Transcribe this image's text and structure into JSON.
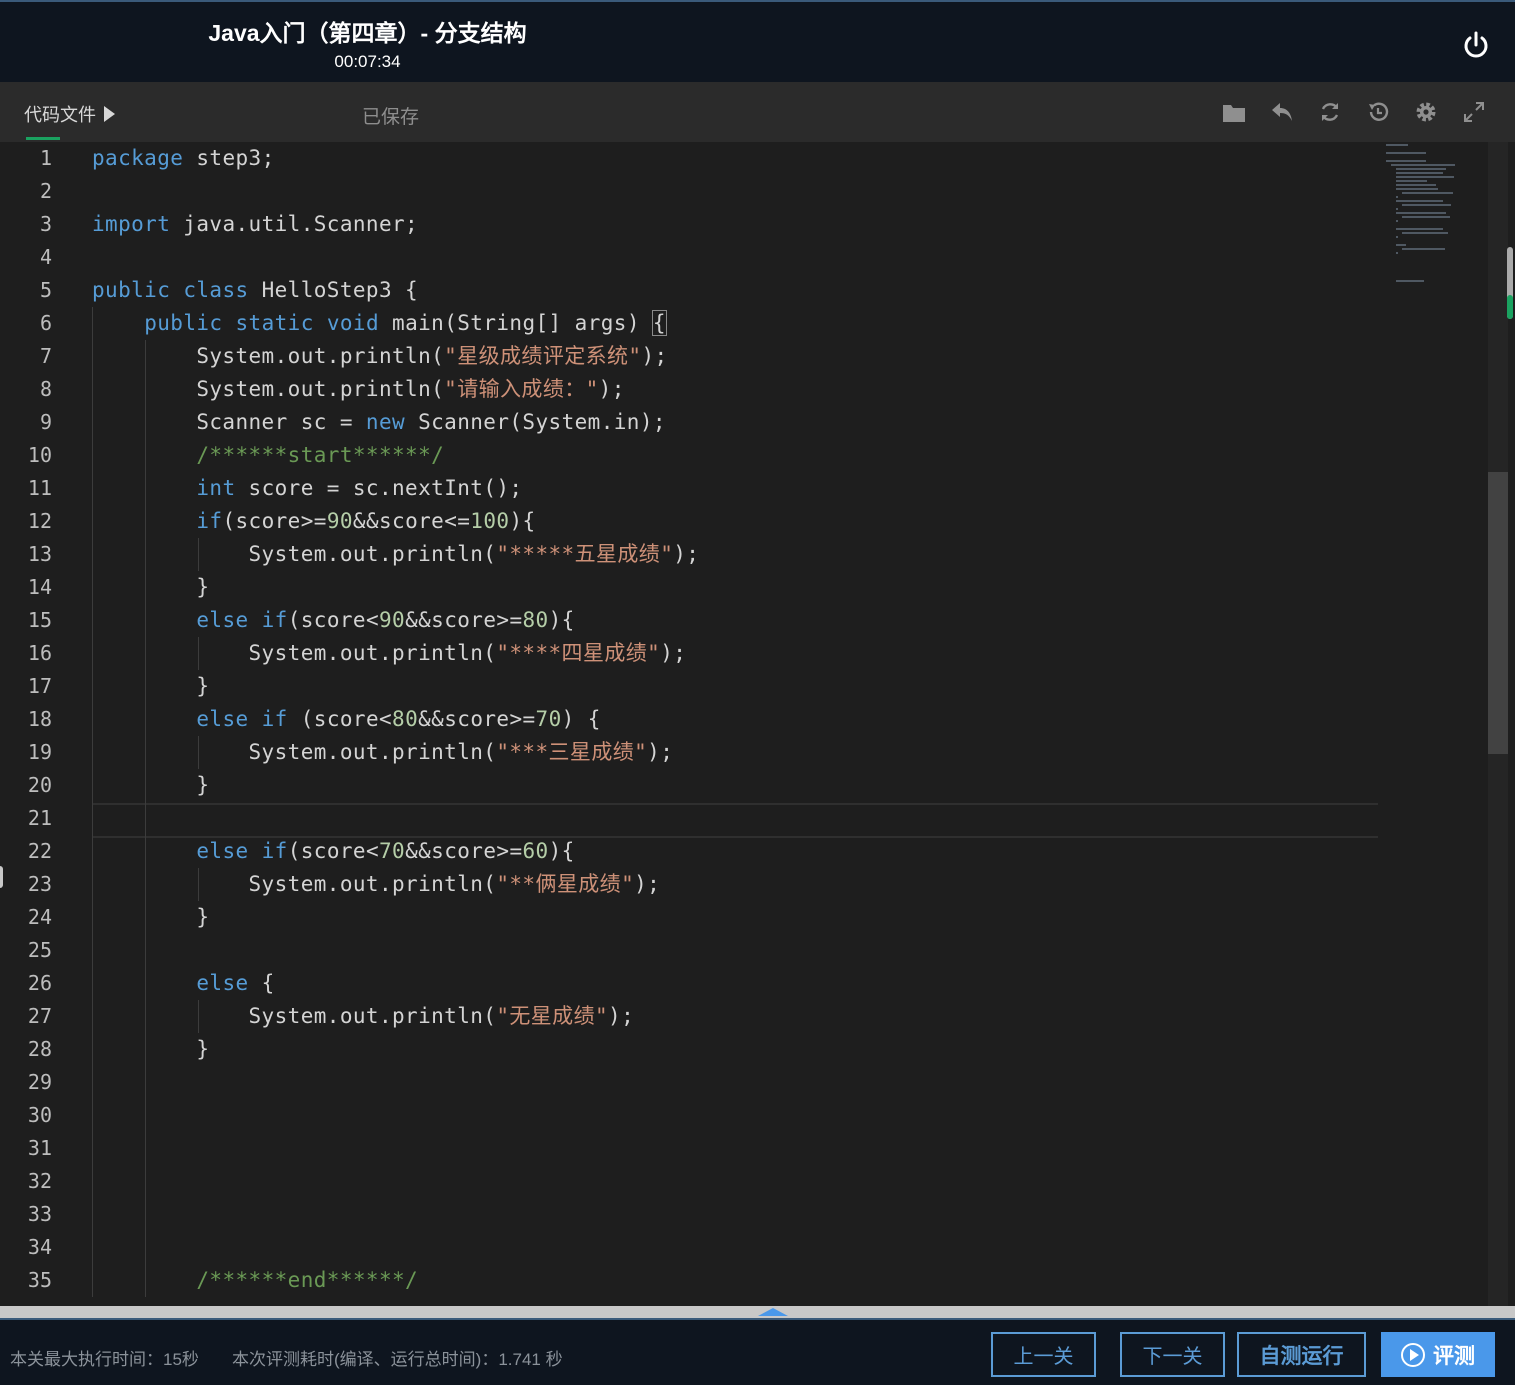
{
  "header": {
    "title": "Java入门（第四章）- 分支结构",
    "timer": "00:07:34",
    "power_icon": "power-icon"
  },
  "toolbar": {
    "files_tab": "代码文件",
    "saved_status": "已保存",
    "icons": [
      "folder-icon",
      "undo-icon",
      "refresh-icon",
      "history-icon",
      "settings-icon",
      "fullscreen-icon"
    ]
  },
  "editor": {
    "language": "java",
    "line_numbers": [
      "1",
      "2",
      "3",
      "4",
      "5",
      "6",
      "7",
      "8",
      "9",
      "10",
      "11",
      "12",
      "13",
      "14",
      "15",
      "16",
      "17",
      "18",
      "19",
      "20",
      "21",
      "22",
      "23",
      "24",
      "25",
      "26",
      "27",
      "28",
      "29",
      "30",
      "31",
      "32",
      "33",
      "34",
      "35"
    ],
    "lines": [
      "package step3;",
      "",
      "import java.util.Scanner;",
      "",
      "public class HelloStep3 {",
      "    public static void main(String[] args) {",
      "        System.out.println(\"星级成绩评定系统\");",
      "        System.out.println(\"请输入成绩：\");",
      "        Scanner sc = new Scanner(System.in);",
      "        /******start******/",
      "        int score = sc.nextInt();",
      "        if(score>=90&&score<=100){",
      "            System.out.println(\"*****五星成绩\");",
      "        }",
      "        else if(score<90&&score>=80){",
      "            System.out.println(\"****四星成绩\");",
      "        }",
      "        else if (score<80&&score>=70) {",
      "            System.out.println(\"***三星成绩\");",
      "        }",
      "",
      "        else if(score<70&&score>=60){",
      "            System.out.println(\"**俩星成绩\");",
      "        }",
      "",
      "        else {",
      "            System.out.println(\"无星成绩\");",
      "        }",
      "",
      "",
      "",
      "",
      "",
      "",
      "        /******end******/"
    ],
    "active_line": 21
  },
  "footer": {
    "max_exec_time": "本关最大执行时间：15秒",
    "eval_time": "本次评测耗时(编译、运行总时间)：1.741 秒",
    "prev_button": "上一关",
    "next_button": "下一关",
    "self_test_button": "自测运行",
    "evaluate_button": "评测"
  },
  "colors": {
    "header_bg": "#0e151f",
    "editor_bg": "#1e1e1e",
    "keyword": "#569cd6",
    "string": "#ce9178",
    "number": "#b5cea8",
    "comment": "#6a9955",
    "accent": "#4a98ea",
    "saved_underline": "#1aa260"
  }
}
